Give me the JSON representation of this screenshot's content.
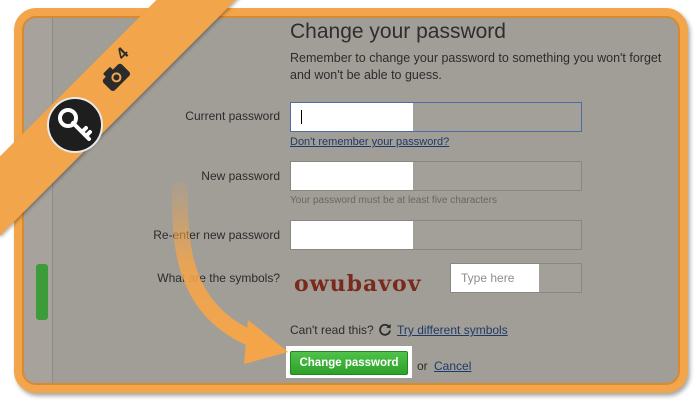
{
  "banner": {
    "step_number": "4",
    "camera_icon": "camera-icon",
    "key_icon": "key-icon"
  },
  "form": {
    "title": "Change your password",
    "description": "Remember to change your password to something you won't forget and won't be able to guess.",
    "current_password": {
      "label": "Current password",
      "value": "",
      "forgot_link": "Don't remember your password?"
    },
    "new_password": {
      "label": "New password",
      "value": "",
      "hint": "Your password must be at least five characters"
    },
    "reenter_password": {
      "label": "Re-enter new password",
      "value": ""
    },
    "captcha": {
      "label": "What are the symbols?",
      "symbols": "owubavov",
      "placeholder": "Type here",
      "cant_read": "Can't read this?",
      "try_link": "Try different symbols"
    },
    "submit_label": "Change password",
    "or_text": "or",
    "cancel_label": "Cancel"
  },
  "colors": {
    "frame": "#f2a54a",
    "submit": "#3aae35",
    "link": "#1f3a66",
    "overlay": "#a19e98"
  }
}
